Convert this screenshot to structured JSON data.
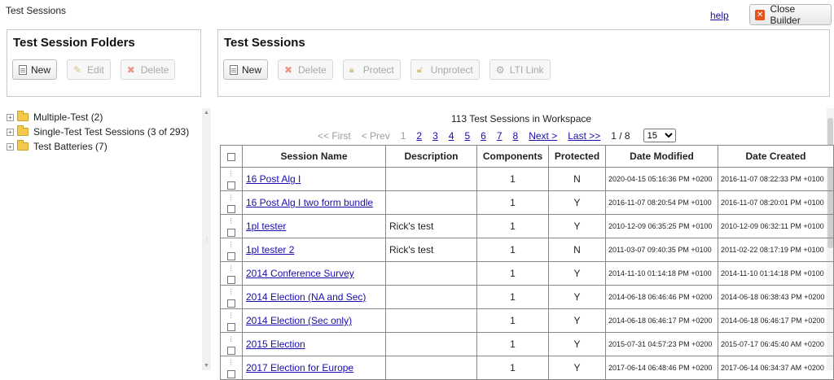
{
  "header": {
    "title": "Test Sessions",
    "help": "help",
    "close_builder": "Close Builder"
  },
  "folders_panel": {
    "title": "Test Session Folders",
    "buttons": {
      "new": "New",
      "edit": "Edit",
      "delete": "Delete"
    }
  },
  "sessions_panel": {
    "title": "Test Sessions",
    "buttons": {
      "new": "New",
      "delete": "Delete",
      "protect": "Protect",
      "unprotect": "Unprotect",
      "lti": "LTI Link"
    }
  },
  "tree": [
    {
      "label": "Multiple-Test (2)"
    },
    {
      "label": "Single-Test Test Sessions (3 of 293)"
    },
    {
      "label": "Test Batteries (7)"
    }
  ],
  "summary": "113 Test Sessions in Workspace",
  "pager": {
    "first": "<< First",
    "prev": "< Prev",
    "pages": [
      "1",
      "2",
      "3",
      "4",
      "5",
      "6",
      "7",
      "8"
    ],
    "next": "Next >",
    "last": "Last >>",
    "position": "1 / 8",
    "page_size": "15"
  },
  "table": {
    "headers": {
      "name": "Session Name",
      "description": "Description",
      "components": "Components",
      "protected": "Protected",
      "modified": "Date Modified",
      "created": "Date Created"
    },
    "rows": [
      {
        "name": "16 Post Alg I",
        "description": "",
        "components": "1",
        "protected": "N",
        "modified": "2020-04-15 05:16:36 PM +0200",
        "created": "2016-11-07 08:22:33 PM +0100"
      },
      {
        "name": "16 Post Alg I two form bundle",
        "description": "",
        "components": "1",
        "protected": "Y",
        "modified": "2016-11-07 08:20:54 PM +0100",
        "created": "2016-11-07 08:20:01 PM +0100"
      },
      {
        "name": "1pl tester",
        "description": "Rick's test",
        "components": "1",
        "protected": "Y",
        "modified": "2010-12-09 06:35:25 PM +0100",
        "created": "2010-12-09 06:32:11 PM +0100"
      },
      {
        "name": "1pl tester 2",
        "description": "Rick's test",
        "components": "1",
        "protected": "N",
        "modified": "2011-03-07 09:40:35 PM +0100",
        "created": "2011-02-22 08:17:19 PM +0100"
      },
      {
        "name": "2014 Conference Survey",
        "description": "",
        "components": "1",
        "protected": "Y",
        "modified": "2014-11-10 01:14:18 PM +0100",
        "created": "2014-11-10 01:14:18 PM +0100"
      },
      {
        "name": "2014 Election (NA and Sec)",
        "description": "",
        "components": "1",
        "protected": "Y",
        "modified": "2014-06-18 06:46:46 PM +0200",
        "created": "2014-06-18 06:38:43 PM +0200"
      },
      {
        "name": "2014 Election (Sec only)",
        "description": "",
        "components": "1",
        "protected": "Y",
        "modified": "2014-06-18 06:46:17 PM +0200",
        "created": "2014-06-18 06:46:17 PM +0200"
      },
      {
        "name": "2015 Election",
        "description": "",
        "components": "1",
        "protected": "Y",
        "modified": "2015-07-31 04:57:23 PM +0200",
        "created": "2015-07-17 06:45:40 AM +0200"
      },
      {
        "name": "2017 Election for Europe",
        "description": "",
        "components": "1",
        "protected": "Y",
        "modified": "2017-06-14 06:48:46 PM +0200",
        "created": "2017-06-14 06:34:37 AM +0200"
      }
    ]
  }
}
